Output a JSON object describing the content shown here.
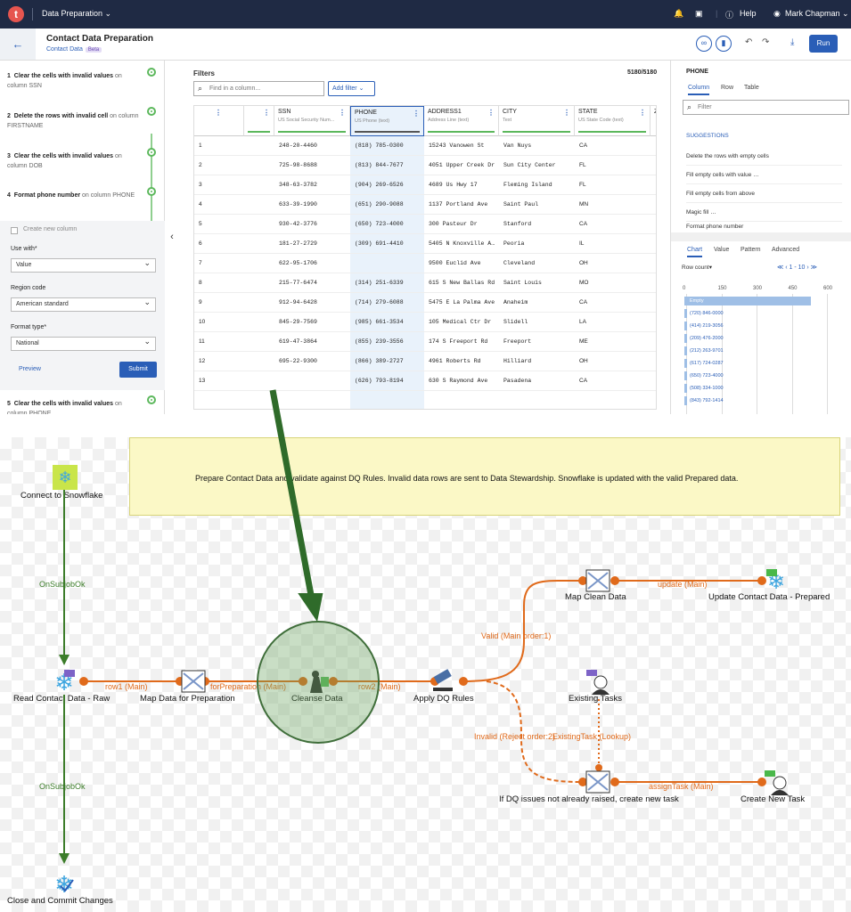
{
  "topbar": {
    "logo": "t",
    "app": "Data Preparation ⌄",
    "help": "Help",
    "user": "Mark Chapman ⌄"
  },
  "header": {
    "title": "Contact Data Preparation",
    "subtitle": "Contact Data",
    "beta": "Beta",
    "run": "Run"
  },
  "steps": [
    {
      "n": "1",
      "title": "Clear the cells with invalid values",
      "rest": " on column SSN"
    },
    {
      "n": "2",
      "title": "Delete the rows with invalid cell",
      "rest": " on column FIRSTNAME"
    },
    {
      "n": "3",
      "title": "Clear the cells with invalid values",
      "rest": " on column DOB"
    },
    {
      "n": "4",
      "title": "Format phone number",
      "rest": " on column PHONE"
    },
    {
      "n": "5",
      "title": "Clear the cells with invalid values",
      "rest": " on column PHONE"
    }
  ],
  "form": {
    "create_new_column": "Create new column",
    "use_with_label": "Use with*",
    "use_with": "Value",
    "region_label": "Region code",
    "region": "American standard",
    "format_label": "Format type*",
    "format": "National",
    "preview": "Preview",
    "submit": "Submit"
  },
  "grid": {
    "filters": "Filters",
    "count": "5180/5180",
    "search_placeholder": "Find in a column...",
    "add_filter": "Add filter ⌄",
    "columns": [
      {
        "name": "SSN",
        "type": "US Social Security Num..."
      },
      {
        "name": "PHONE",
        "type": "US Phone (text)"
      },
      {
        "name": "ADDRESS1",
        "type": "Address Line (text)"
      },
      {
        "name": "CITY",
        "type": "Text"
      },
      {
        "name": "STATE",
        "type": "US State Code (text)"
      },
      {
        "name": "Z",
        "type": ""
      }
    ],
    "rows": [
      [
        "1",
        "248-20-4460",
        "(818) 785-0300",
        "15243 Vanowen St",
        "Van Nuys",
        "CA"
      ],
      [
        "2",
        "725-98-8688",
        "(813) 844-7677",
        "4051 Upper Creek Dr",
        "Sun City Center",
        "FL"
      ],
      [
        "3",
        "348-63-3782",
        "(904) 269-6526",
        "4689 Us Hwy 17",
        "Fleming Island",
        "FL"
      ],
      [
        "4",
        "633-39-1990",
        "(651) 290-9088",
        "1137 Portland Ave",
        "Saint Paul",
        "MN"
      ],
      [
        "5",
        "930-42-3776",
        "(650) 723-4000",
        "300 Pasteur Dr",
        "Stanford",
        "CA"
      ],
      [
        "6",
        "181-27-2729",
        "(309) 691-4410",
        "5405 N Knoxville A…",
        "Peoria",
        "IL"
      ],
      [
        "7",
        "622-95-1706",
        "",
        "9500 Euclid Ave",
        "Cleveland",
        "OH"
      ],
      [
        "8",
        "215-77-6474",
        "(314) 251-6339",
        "615 S New Ballas Rd",
        "Saint Louis",
        "MO"
      ],
      [
        "9",
        "912-94-6428",
        "(714) 279-6088",
        "5475 E La Palma Ave",
        "Anaheim",
        "CA"
      ],
      [
        "10",
        "845-29-7569",
        "(985) 661-3534",
        "105 Medical Ctr Dr",
        "Slidell",
        "LA"
      ],
      [
        "11",
        "619-47-3864",
        "(855) 239-3556",
        "174 S Freeport Rd",
        "Freeport",
        "ME"
      ],
      [
        "12",
        "695-22-9300",
        "(866) 389-2727",
        "4961 Roberts Rd",
        "Hilliard",
        "OH"
      ],
      [
        "13",
        "",
        "(626) 793-8194",
        "630 S Raymond Ave",
        "Pasadena",
        "CA"
      ]
    ]
  },
  "right": {
    "column": "PHONE",
    "tabs": [
      "Column",
      "Row",
      "Table"
    ],
    "filter_placeholder": "Filter",
    "suggestions_header": "SUGGESTIONS",
    "suggestions": [
      "Delete the rows with empty cells",
      "Fill empty cells with value …",
      "Fill empty cells from above",
      "Magic fill …",
      "Format phone number"
    ],
    "chart_tabs": [
      "Chart",
      "Value",
      "Pattern",
      "Advanced"
    ],
    "row_count": "Row count▾",
    "pager": "≪ ‹ 1 - 10 › ≫",
    "axis": [
      "0",
      "150",
      "300",
      "450",
      "600"
    ],
    "bars": [
      {
        "label": "Empty",
        "value": 540
      },
      {
        "label": "(720) 846-0000",
        "value": 4
      },
      {
        "label": "(414) 219-3056",
        "value": 3
      },
      {
        "label": "(209) 476-2000",
        "value": 3
      },
      {
        "label": "(212) 263-9701",
        "value": 3
      },
      {
        "label": "(617) 724-0287",
        "value": 3
      },
      {
        "label": "(650) 723-4000",
        "value": 3
      },
      {
        "label": "(508) 334-1000",
        "value": 3
      },
      {
        "label": "(843) 792-1414",
        "value": 3
      }
    ]
  },
  "flow": {
    "note": "Prepare Contact Data and validate against DQ Rules. Invalid data rows are sent to Data Stewardship. Snowflake is updated with the valid Prepared data.",
    "nodes": {
      "connect": "Connect to Snowflake",
      "read": "Read Contact Data - Raw",
      "map_prep": "Map Data for Preparation",
      "cleanse": "Cleanse Data",
      "apply_dq": "Apply DQ Rules",
      "map_clean": "Map Clean Data",
      "update": "Update Contact Data - Prepared",
      "existing": "Existing Tasks",
      "if_dq": "If DQ issues not already raised, create new task",
      "create_task": "Create New Task",
      "close": "Close and Commit Changes"
    },
    "links": {
      "onsubjob1": "OnSubjobOk",
      "onsubjob2": "OnSubjobOk",
      "row1": "row1 (Main)",
      "forprep": "forPreparation (Main)",
      "row2": "row2 (Main)",
      "valid": "Valid (Main order:1)",
      "update": "update (Main)",
      "invalid": "Invalid (Reject order:2)",
      "existing_task": "ExistingTask (Lookup)",
      "assign": "assignTask (Main)"
    }
  },
  "colors": {
    "accent": "#2a5eb7",
    "flow_link": "#e06a1b",
    "trigger": "#3c7d2a",
    "annotation_arrow": "#2f6b2a"
  }
}
